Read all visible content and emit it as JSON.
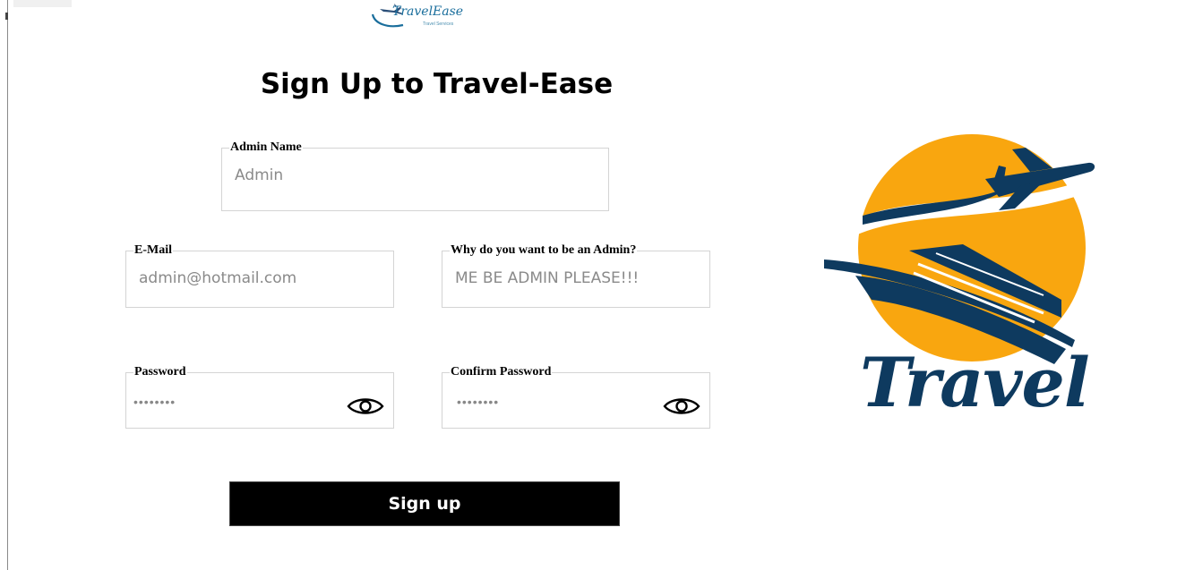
{
  "brand": {
    "name": "TravelEase",
    "tagline": "Travel Services"
  },
  "page": {
    "title": "Sign Up to Travel-Ease"
  },
  "form": {
    "admin_name": {
      "label": "Admin Name",
      "placeholder": "Admin"
    },
    "email": {
      "label": "E-Mail",
      "placeholder": "admin@hotmail.com"
    },
    "reason": {
      "label": "Why do you want to be an Admin?",
      "placeholder": "ME BE ADMIN PLEASE!!!"
    },
    "password": {
      "label": "Password",
      "masked_value": "••••••••",
      "toggle_icon": "eye-icon"
    },
    "confirm_password": {
      "label": "Confirm Password",
      "masked_value": "••••••••",
      "toggle_icon": "eye-icon"
    },
    "submit_label": "Sign up"
  },
  "illustration": {
    "word": "Travel",
    "colors": {
      "sun": "#f9a60f",
      "navy": "#0e3a5f"
    }
  }
}
